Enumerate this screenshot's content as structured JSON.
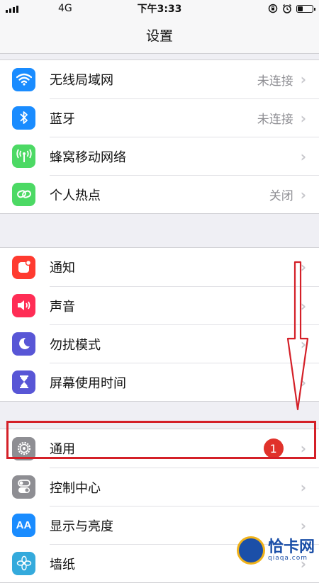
{
  "status_bar": {
    "network": "4G",
    "time": "下午3:33"
  },
  "nav": {
    "title": "设置"
  },
  "groups": [
    {
      "items": [
        {
          "label": "无线局域网",
          "value": "未连接",
          "icon": "wifi-icon",
          "color": "#1a8cff"
        },
        {
          "label": "蓝牙",
          "value": "未连接",
          "icon": "bluetooth-icon",
          "color": "#1a8cff"
        },
        {
          "label": "蜂窝移动网络",
          "value": "",
          "icon": "antenna-icon",
          "color": "#4cd964"
        },
        {
          "label": "个人热点",
          "value": "关闭",
          "icon": "hotspot-icon",
          "color": "#4cd964"
        }
      ]
    },
    {
      "items": [
        {
          "label": "通知",
          "value": "",
          "icon": "notifications-icon",
          "color": "#ff3b30"
        },
        {
          "label": "声音",
          "value": "",
          "icon": "speaker-icon",
          "color": "#ff2d55"
        },
        {
          "label": "勿扰模式",
          "value": "",
          "icon": "moon-icon",
          "color": "#5856d6"
        },
        {
          "label": "屏幕使用时间",
          "value": "",
          "icon": "hourglass-icon",
          "color": "#5856d6"
        }
      ]
    },
    {
      "items": [
        {
          "label": "通用",
          "value": "",
          "badge": "1",
          "icon": "gear-icon",
          "color": "#8e8e93"
        },
        {
          "label": "控制中心",
          "value": "",
          "icon": "toggles-icon",
          "color": "#8e8e93"
        },
        {
          "label": "显示与亮度",
          "value": "",
          "icon": "text-size-icon",
          "color": "#1a8cff",
          "icon_text": "AA"
        },
        {
          "label": "墙纸",
          "value": "",
          "icon": "flower-icon",
          "color": "#34aadc"
        }
      ]
    }
  ],
  "watermark": {
    "main": "恰卡网",
    "sub": "qiaqa.com"
  }
}
